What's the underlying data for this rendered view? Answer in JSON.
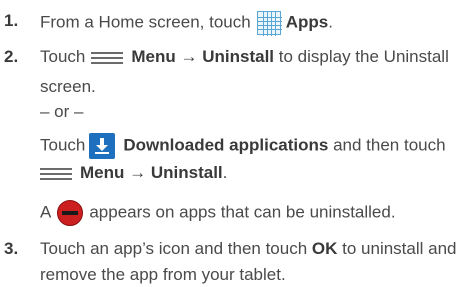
{
  "steps": [
    {
      "number": "1.",
      "p1": "From a Home screen, touch",
      "apps_label": "Apps",
      "p2": "."
    },
    {
      "number": "2.",
      "touch": "Touch",
      "menu_label": "Menu",
      "arrow": "→",
      "uninstall_label": "Uninstall",
      "rest_line1": "to display the Uninstall",
      "rest_line2": "screen.",
      "or": "– or –",
      "touch2": "Touch",
      "downloaded_label": "Downloaded applications",
      "and_then": "and then touch",
      "menu_label2": "Menu",
      "arrow2": "→",
      "uninstall_label2": "Uninstall",
      "period": ".",
      "a_prefix": "A",
      "a_suffix": "appears on apps that can be uninstalled."
    },
    {
      "number": "3.",
      "line1_pre": "Touch an app’s icon and then touch",
      "ok_label": "OK",
      "line1_post": "to uninstall and",
      "line2": "remove the app from your tablet."
    }
  ],
  "icons": {
    "apps": "apps-grid-icon",
    "menu": "menu-icon",
    "downloaded": "download-icon",
    "remove": "remove-icon"
  },
  "colors": {
    "text": "#4a4a4a",
    "apps_border": "#5aa7d6",
    "download_bg": "#1f6fbf",
    "remove_red": "#cc1f1f"
  }
}
